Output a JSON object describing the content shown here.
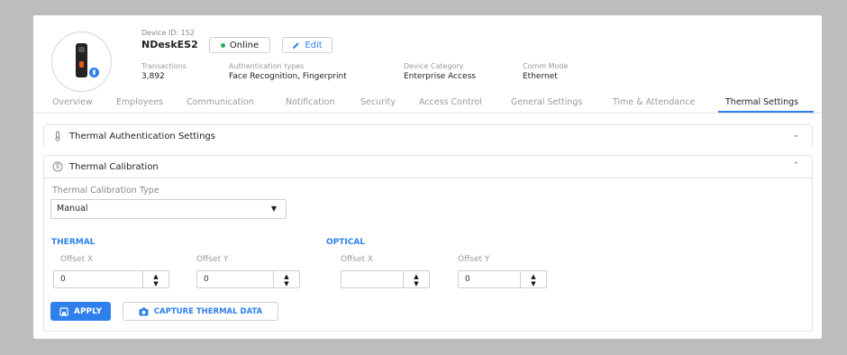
{
  "device": {
    "id_text": "Device ID: 152",
    "name": "NDeskES2",
    "status": "Online",
    "edit_label": "Edit",
    "status_color": "#27ae60",
    "accent_color": "#2f80ed"
  },
  "meta": [
    {
      "label": "Transactions",
      "value": "3,892"
    },
    {
      "label": "Authentication types",
      "value": "Face Recognition, Fingerprint"
    },
    {
      "label": "Device Category",
      "value": "Enterprise Access"
    },
    {
      "label": "Comm Mode",
      "value": "Ethernet"
    }
  ],
  "tabs": [
    "Overview",
    "Employees",
    "Communication",
    "Notification",
    "Security",
    "Access Control",
    "General Settings",
    "Time & Attendance",
    "Thermal Settings"
  ],
  "active_tab": "Thermal Settings",
  "panels": {
    "auth": {
      "title": "Thermal Authentication Settings",
      "icon": "thermometer-icon",
      "collapsed": true
    },
    "calibration": {
      "title": "Thermal Calibration",
      "icon": "calibration-icon",
      "collapsed": false
    }
  },
  "calibration": {
    "type_label": "Thermal Calibration Type",
    "type_value": "Manual",
    "thermal_label": "THERMAL",
    "optical_label": "OPTICAL",
    "offset_x_label": "Offset X",
    "offset_y_label": "Offset Y",
    "thermal_offset_x": "0",
    "thermal_offset_y": "0",
    "optical_offset_x": "",
    "optical_offset_y": "0"
  },
  "buttons": {
    "apply": "APPLY",
    "capture": "CAPTURE THERMAL DATA"
  }
}
